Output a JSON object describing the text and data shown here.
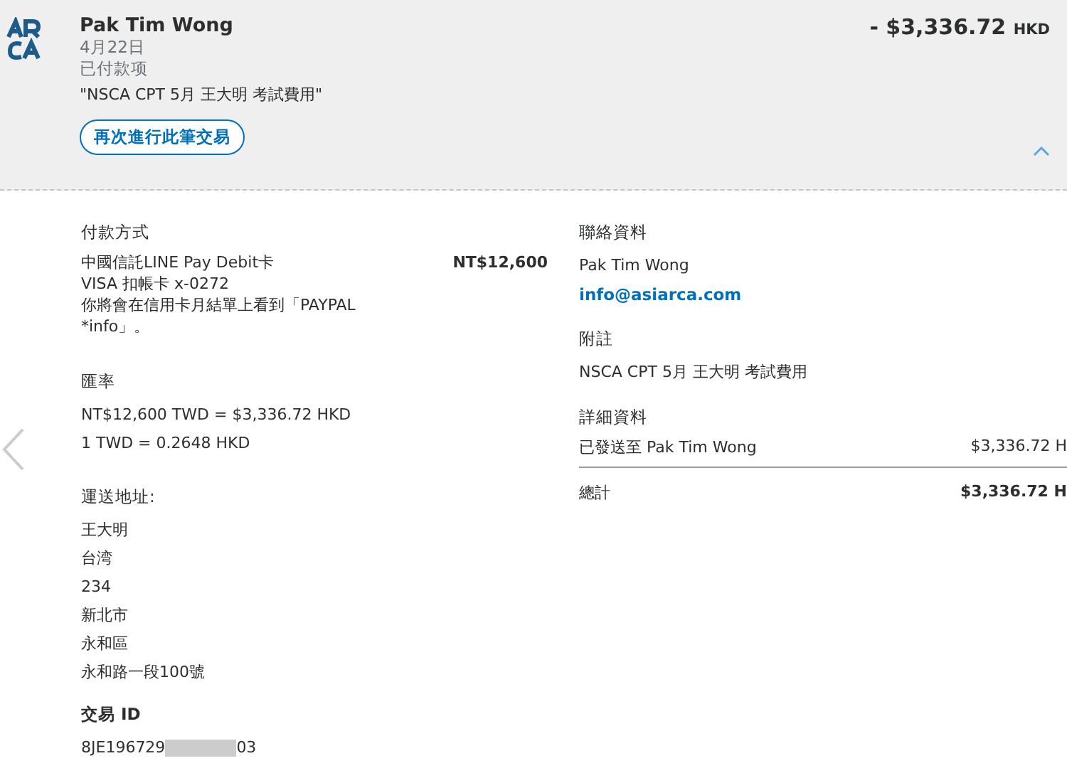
{
  "header": {
    "name": "Pak Tim Wong",
    "date": "4月22日",
    "status": "已付款项",
    "memo": "\"NSCA CPT 5月 王大明 考試費用\"",
    "repeat_button": "再次進行此筆交易",
    "amount": "- $3,336.72",
    "currency": "HKD",
    "expanded": true
  },
  "payment": {
    "heading": "付款方式",
    "card": "中國信託LINE Pay Debit卡",
    "card_amount": "NT$12,600",
    "card_number": "VISA 扣帳卡 x-0272",
    "note": "你將會在信用卡月結單上看到「PAYPAL *info」。"
  },
  "exchange": {
    "heading": "匯率",
    "conversion": "NT$12,600 TWD = $3,336.72 HKD",
    "rate": "1 TWD = 0.2648 HKD"
  },
  "shipping": {
    "heading": "運送地址:",
    "lines": [
      "王大明",
      "台湾",
      "234",
      "新北市",
      "永和區",
      "永和路一段100號"
    ]
  },
  "transaction": {
    "heading": "交易 ID",
    "id_start": "8JE196729",
    "id_end": "03"
  },
  "contact": {
    "heading": "聯絡資料",
    "name": "Pak Tim Wong",
    "email": "info@asiarca.com"
  },
  "note": {
    "heading": "附註",
    "text": "NSCA CPT 5月 王大明 考試費用"
  },
  "details": {
    "heading": "詳細資料",
    "rows": [
      {
        "label": "已發送至 Pak Tim Wong",
        "amount": "$3,336.72 H"
      }
    ],
    "total_label": "總計",
    "total_amount": "$3,336.72 H"
  }
}
